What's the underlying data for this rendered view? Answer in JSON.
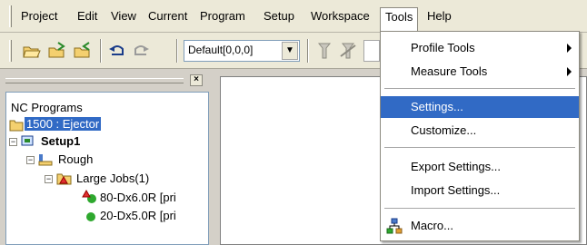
{
  "menubar": {
    "items": [
      "Project",
      "Edit",
      "View",
      "Current",
      "Program",
      "Setup",
      "Workspace",
      "Tools",
      "Help"
    ],
    "active": "Tools"
  },
  "toolbar": {
    "combo_value": "Default[0,0,0]"
  },
  "left_panel": {
    "title": "NC Programs",
    "tree": [
      {
        "label": "1500 : Ejector",
        "selected": true
      },
      {
        "label": "Setup1"
      },
      {
        "label": "Rough"
      },
      {
        "label": "Large Jobs(1)"
      },
      {
        "label": "80-Dx6.0R [pri"
      },
      {
        "label": "20-Dx5.0R [pri"
      }
    ]
  },
  "tools_menu": {
    "items": [
      {
        "label": "Profile Tools",
        "submenu": true
      },
      {
        "label": "Measure Tools",
        "submenu": true
      },
      {
        "label": "Settings...",
        "selected": true
      },
      {
        "label": "Customize..."
      },
      {
        "label": "Export Settings..."
      },
      {
        "label": "Import Settings..."
      },
      {
        "label": "Macro...",
        "icon": "macro-icon"
      }
    ],
    "highlight_color": "#316ac5"
  },
  "colors": {
    "selection": "#316ac5",
    "chrome": "#ece9d8",
    "panel": "#d4d0c8"
  }
}
